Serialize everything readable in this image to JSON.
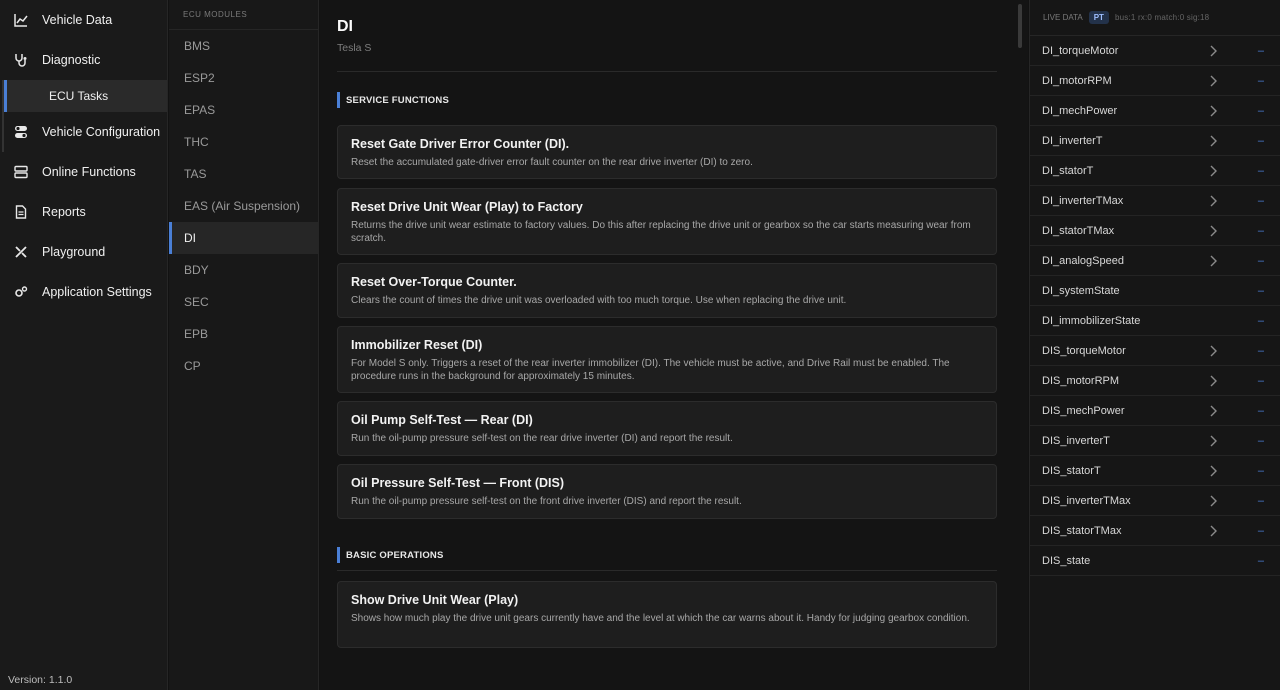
{
  "nav": {
    "items": [
      {
        "label": "Vehicle Data",
        "icon": "chart-line-icon"
      },
      {
        "label": "Diagnostic",
        "icon": "stethoscope-icon"
      },
      {
        "label": "Vehicle Configuration",
        "icon": "toggles-icon"
      },
      {
        "label": "Online Functions",
        "icon": "server-icon"
      },
      {
        "label": "Reports",
        "icon": "document-icon"
      },
      {
        "label": "Playground",
        "icon": "tools-icon"
      },
      {
        "label": "Application Settings",
        "icon": "gears-icon"
      }
    ],
    "sub_item": "ECU Tasks",
    "version": "Version: 1.1.0"
  },
  "modules": {
    "header": "ECU MODULES",
    "items": [
      "BMS",
      "ESP2",
      "EPAS",
      "THC",
      "TAS",
      "EAS (Air Suspension)",
      "DI",
      "BDY",
      "SEC",
      "EPB",
      "CP"
    ],
    "active": "DI"
  },
  "main": {
    "title": "DI",
    "subtitle": "Tesla S",
    "sections": [
      {
        "header": "SERVICE FUNCTIONS",
        "cards": [
          {
            "title": "Reset Gate Driver Error Counter (DI).",
            "desc": "Reset the accumulated gate-driver error fault counter on the rear drive inverter (DI) to zero."
          },
          {
            "title": "Reset Drive Unit Wear (Play) to Factory",
            "desc": "Returns the drive unit wear estimate to factory values. Do this after replacing the drive unit or gearbox so the car starts measuring wear from scratch."
          },
          {
            "title": "Reset Over-Torque Counter.",
            "desc": "Clears the count of times the drive unit was overloaded with too much torque. Use when replacing the drive unit."
          },
          {
            "title": "Immobilizer Reset (DI)",
            "desc": "For Model S only. Triggers a reset of the rear inverter immobilizer (DI). The vehicle must be active, and Drive Rail must be enabled. The procedure runs in the background for approximately 15 minutes."
          },
          {
            "title": "Oil Pump Self-Test — Rear (DI)",
            "desc": "Run the oil-pump pressure self-test on the rear drive inverter (DI) and report the result."
          },
          {
            "title": "Oil Pressure Self-Test — Front (DIS)",
            "desc": "Run the oil-pump pressure self-test on the front drive inverter (DIS) and report the result."
          }
        ]
      },
      {
        "header": "BASIC OPERATIONS",
        "cards": [
          {
            "title": "Show Drive Unit Wear (Play)",
            "desc": "Shows how much play the drive unit gears currently have and the level at which the car warns about it. Handy for judging gearbox condition."
          }
        ]
      }
    ]
  },
  "live": {
    "header": "LIVE DATA",
    "badge": "PT",
    "stats": "bus:1  rx:0  match:0  sig:18",
    "signals": [
      {
        "name": "DI_torqueMotor",
        "value": "–",
        "expandable": true
      },
      {
        "name": "DI_motorRPM",
        "value": "–",
        "expandable": true
      },
      {
        "name": "DI_mechPower",
        "value": "–",
        "expandable": true
      },
      {
        "name": "DI_inverterT",
        "value": "–",
        "expandable": true
      },
      {
        "name": "DI_statorT",
        "value": "–",
        "expandable": true
      },
      {
        "name": "DI_inverterTMax",
        "value": "–",
        "expandable": true
      },
      {
        "name": "DI_statorTMax",
        "value": "–",
        "expandable": true
      },
      {
        "name": "DI_analogSpeed",
        "value": "–",
        "expandable": true
      },
      {
        "name": "DI_systemState",
        "value": "–",
        "expandable": false
      },
      {
        "name": "DI_immobilizerState",
        "value": "–",
        "expandable": false
      },
      {
        "name": "DIS_torqueMotor",
        "value": "–",
        "expandable": true
      },
      {
        "name": "DIS_motorRPM",
        "value": "–",
        "expandable": true
      },
      {
        "name": "DIS_mechPower",
        "value": "–",
        "expandable": true
      },
      {
        "name": "DIS_inverterT",
        "value": "–",
        "expandable": true
      },
      {
        "name": "DIS_statorT",
        "value": "–",
        "expandable": true
      },
      {
        "name": "DIS_inverterTMax",
        "value": "–",
        "expandable": true
      },
      {
        "name": "DIS_statorTMax",
        "value": "–",
        "expandable": true
      },
      {
        "name": "DIS_state",
        "value": "–",
        "expandable": false
      }
    ]
  },
  "colors": {
    "accent": "#4a7fd6",
    "background": "#121212",
    "card": "#1e1e1e"
  }
}
